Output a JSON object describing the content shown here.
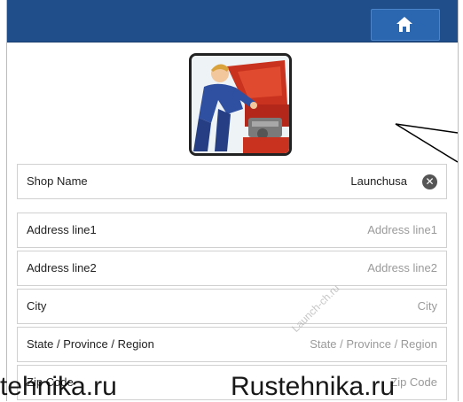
{
  "header": {
    "home_icon": "home-icon",
    "bar_color": "#1f4e8a"
  },
  "logo": {
    "icon": "mechanic-illustration"
  },
  "fields": [
    {
      "label": "Shop Name",
      "value": "Launchusa",
      "placeholder": ""
    },
    {
      "label": "Address line1",
      "value": "",
      "placeholder": "Address line1"
    },
    {
      "label": "Address line2",
      "value": "",
      "placeholder": "Address line2"
    },
    {
      "label": "City",
      "value": "",
      "placeholder": "City"
    },
    {
      "label": "State / Province / Region",
      "value": "",
      "placeholder": "State / Province / Region"
    },
    {
      "label": "Zip Code",
      "value": "",
      "placeholder": "Zip Code"
    }
  ],
  "clear_icon": "clear-icon",
  "watermarks": {
    "left": "tehnika.ru",
    "right": "Rustehnika.ru",
    "diagonal": "Launch-ch.ru"
  }
}
